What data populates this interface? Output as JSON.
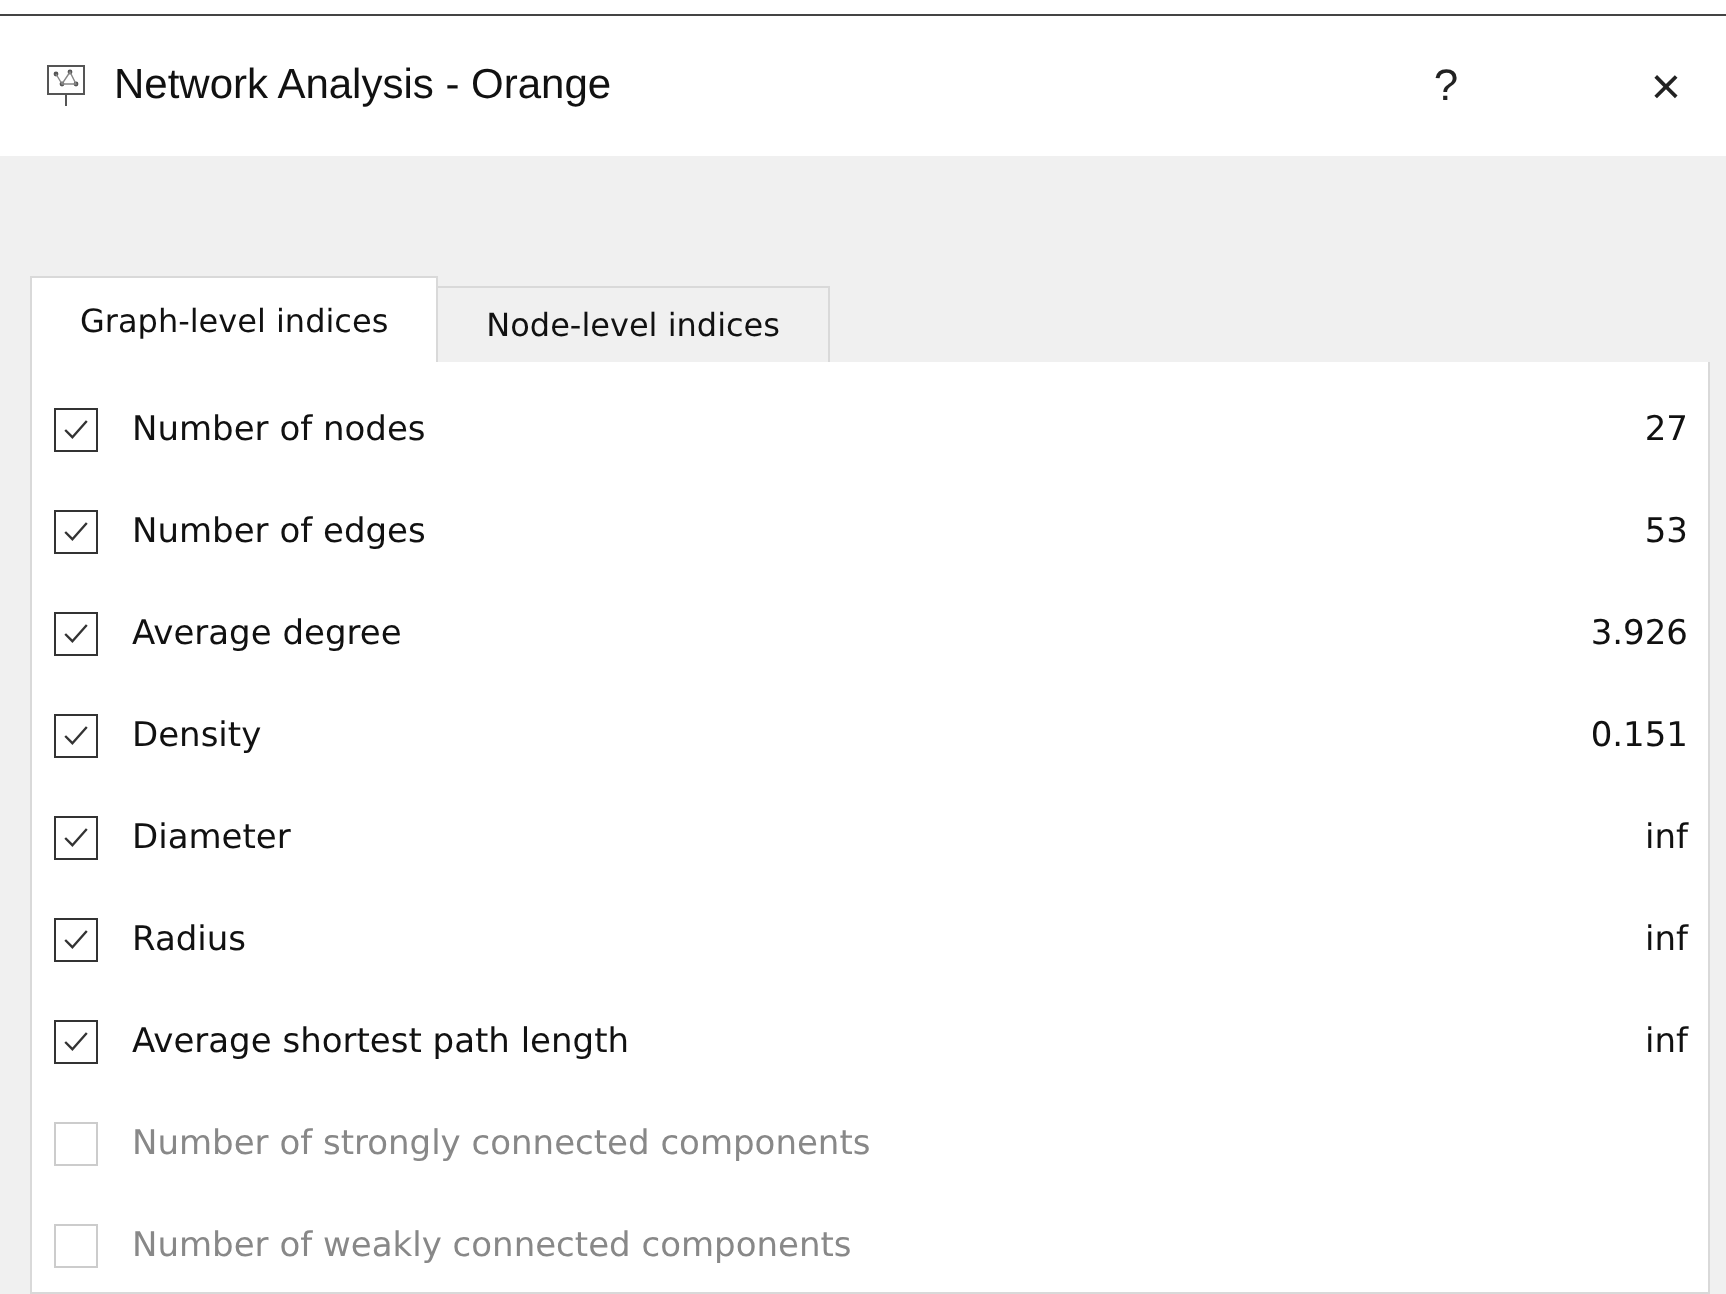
{
  "window": {
    "title": "Network Analysis - Orange",
    "help": "?",
    "close": "×"
  },
  "tabs": [
    {
      "label": "Graph-level indices",
      "selected": true
    },
    {
      "label": "Node-level indices",
      "selected": false
    }
  ],
  "indices": [
    {
      "label": "Number of nodes",
      "checked": true,
      "disabled": false,
      "value": "27"
    },
    {
      "label": "Number of edges",
      "checked": true,
      "disabled": false,
      "value": "53"
    },
    {
      "label": "Average degree",
      "checked": true,
      "disabled": false,
      "value": "3.926"
    },
    {
      "label": "Density",
      "checked": true,
      "disabled": false,
      "value": "0.151"
    },
    {
      "label": "Diameter",
      "checked": true,
      "disabled": false,
      "value": "inf"
    },
    {
      "label": "Radius",
      "checked": true,
      "disabled": false,
      "value": "inf"
    },
    {
      "label": "Average shortest path length",
      "checked": true,
      "disabled": false,
      "value": "inf"
    },
    {
      "label": "Number of strongly connected components",
      "checked": false,
      "disabled": true
    },
    {
      "label": "Number of weakly connected components",
      "checked": false,
      "disabled": true
    }
  ]
}
